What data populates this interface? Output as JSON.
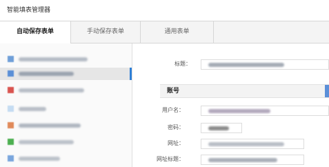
{
  "app": {
    "title": "智能填表管理器"
  },
  "tabs": [
    {
      "label": "自动保存表单",
      "active": true
    },
    {
      "label": "手动保存表单",
      "active": false
    },
    {
      "label": "通用表单",
      "active": false
    }
  ],
  "accent_color": "#2f7fd6",
  "sidebar": {
    "items": [
      {
        "icon": "site-favicon-blue-icon",
        "selected": false
      },
      {
        "icon": "site-favicon-blue-icon",
        "selected": true
      },
      {
        "icon": "site-favicon-red-icon",
        "selected": false
      },
      {
        "icon": "site-favicon-lightblue-icon",
        "selected": false
      },
      {
        "icon": "site-favicon-orange-icon",
        "selected": false
      },
      {
        "icon": "site-favicon-green-icon",
        "selected": false
      },
      {
        "icon": "site-favicon-blue-icon",
        "selected": false
      }
    ]
  },
  "form": {
    "title_label": "标题：",
    "section_label": "账号",
    "username_label": "用户名：",
    "password_label": "密码：",
    "url_label": "网址：",
    "page_title_label": "网址标题："
  }
}
